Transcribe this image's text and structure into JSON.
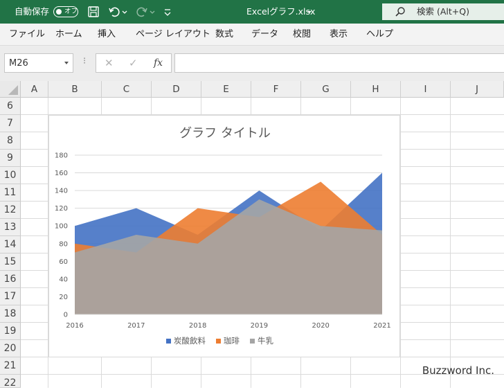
{
  "titlebar": {
    "autosave_label": "自動保存",
    "autosave_state": "オフ",
    "filename": "Excelグラフ.xlsx",
    "search_text": "検索 (Alt+Q)",
    "colors": {
      "bar": "#217346",
      "search_bg": "#e6efe9"
    }
  },
  "ribbon": {
    "tabs": [
      "ファイル",
      "ホーム",
      "挿入",
      "ページ レイアウト",
      "数式",
      "データ",
      "校閲",
      "表示",
      "ヘルプ"
    ]
  },
  "formula_bar": {
    "name_box": "M26",
    "cancel": "✕",
    "enter": "✓",
    "fx": "fx",
    "formula": ""
  },
  "grid": {
    "columns": [
      "A",
      "B",
      "C",
      "D",
      "E",
      "F",
      "G",
      "H",
      "I",
      "J"
    ],
    "rows": [
      "6",
      "7",
      "8",
      "9",
      "10",
      "11",
      "12",
      "13",
      "14",
      "15",
      "16",
      "17",
      "18",
      "19",
      "20",
      "21",
      "22"
    ]
  },
  "chart_data": {
    "type": "area",
    "title": "グラフ タイトル",
    "x": [
      "2016",
      "2017",
      "2018",
      "2019",
      "2020",
      "2021"
    ],
    "ylim": [
      0,
      180
    ],
    "yticks": [
      0,
      20,
      40,
      60,
      80,
      100,
      120,
      140,
      160,
      180
    ],
    "grid": true,
    "legend": "bottom",
    "series": [
      {
        "name": "炭酸飲料",
        "color": "#4472c4",
        "values": [
          100,
          120,
          90,
          140,
          95,
          160
        ]
      },
      {
        "name": "珈琲",
        "color": "#ed7d31",
        "values": [
          80,
          70,
          120,
          110,
          150,
          90
        ]
      },
      {
        "name": "牛乳",
        "color": "#a5a5a5",
        "values": [
          70,
          90,
          80,
          130,
          100,
          95
        ]
      }
    ]
  },
  "watermark": "Buzzword Inc."
}
